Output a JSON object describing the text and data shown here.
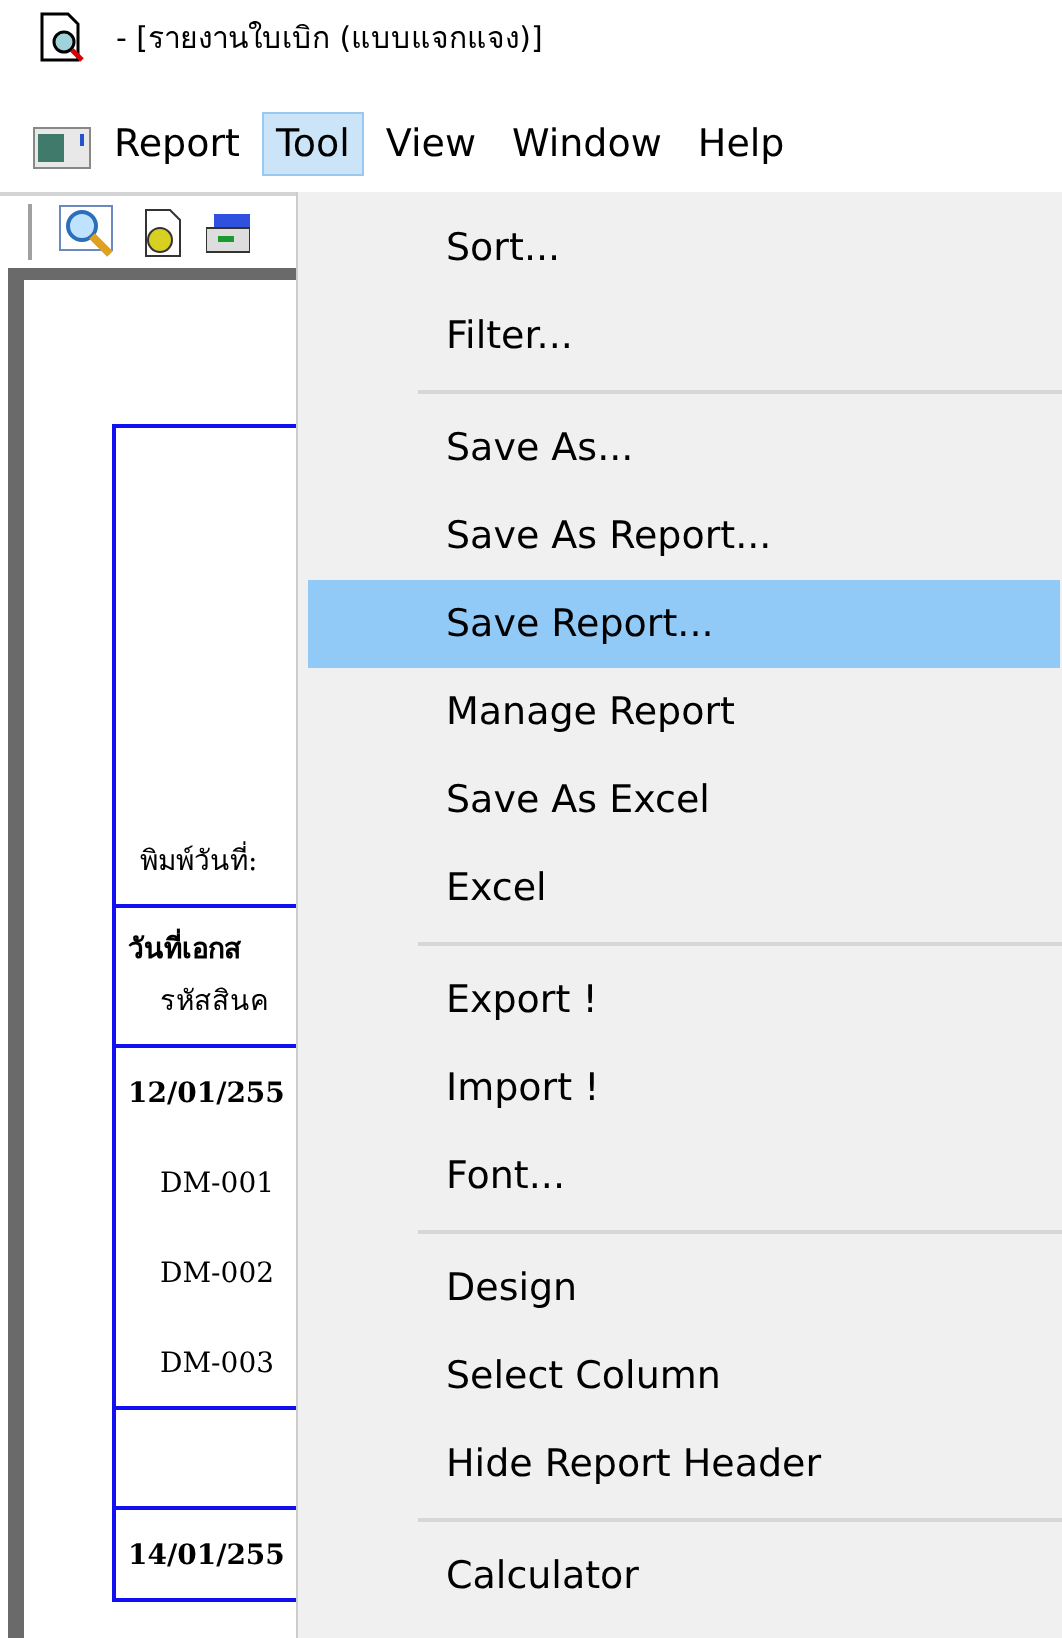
{
  "window": {
    "title": "- [รายงานใบเบิก (แบบแจกแจง)]"
  },
  "menu_bar": [
    {
      "label": "Report",
      "selected": false
    },
    {
      "label": "Tool",
      "selected": true
    },
    {
      "label": "View",
      "selected": false
    },
    {
      "label": "Window",
      "selected": false
    },
    {
      "label": "Help",
      "selected": false
    }
  ],
  "report": {
    "print_date_label": "พิมพ์วันที่:",
    "header_lines": [
      "วันที่เอกส",
      "รหัสสินค"
    ],
    "groups": [
      {
        "date": "12/01/255",
        "items": [
          "DM-001",
          "DM-002",
          "DM-003"
        ]
      },
      {
        "date": "14/01/255"
      }
    ]
  },
  "tool_menu": [
    {
      "kind": "item",
      "label": "Sort...",
      "selected": false
    },
    {
      "kind": "item",
      "label": "Filter...",
      "selected": false
    },
    {
      "kind": "separator"
    },
    {
      "kind": "item",
      "label": "Save As...",
      "selected": false
    },
    {
      "kind": "item",
      "label": "Save As Report...",
      "selected": false
    },
    {
      "kind": "item",
      "label": "Save Report...",
      "selected": true
    },
    {
      "kind": "item",
      "label": "Manage Report",
      "selected": false
    },
    {
      "kind": "item",
      "label": "Save As Excel",
      "selected": false
    },
    {
      "kind": "item",
      "label": "Excel",
      "selected": false
    },
    {
      "kind": "separator"
    },
    {
      "kind": "item",
      "label": "Export !",
      "selected": false
    },
    {
      "kind": "item",
      "label": "Import !",
      "selected": false
    },
    {
      "kind": "item",
      "label": "Font...",
      "selected": false
    },
    {
      "kind": "separator"
    },
    {
      "kind": "item",
      "label": "Design",
      "selected": false
    },
    {
      "kind": "item",
      "label": "Select Column",
      "selected": false
    },
    {
      "kind": "item",
      "label": "Hide Report Header",
      "selected": false
    },
    {
      "kind": "separator"
    },
    {
      "kind": "item",
      "label": "Calculator",
      "selected": false
    }
  ]
}
